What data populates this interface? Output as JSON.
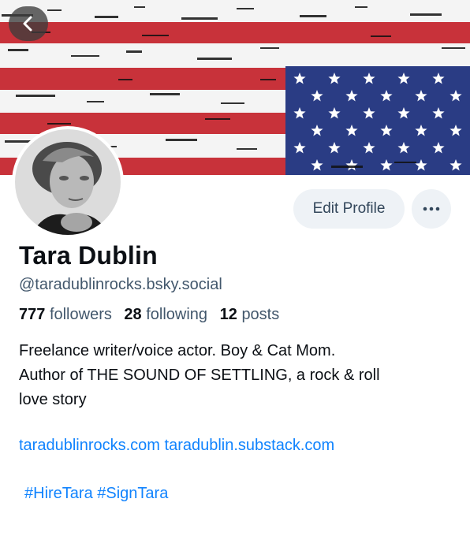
{
  "profile": {
    "display_name": "Tara Dublin",
    "handle": "@taradublinrocks.bsky.social",
    "stats": {
      "followers_count": "777",
      "followers_label": "followers",
      "following_count": "28",
      "following_label": "following",
      "posts_count": "12",
      "posts_label": "posts"
    },
    "bio_lines": [
      "Freelance writer/voice actor. Boy & Cat Mom.",
      "Author of THE SOUND OF SETTLING, a rock & roll",
      "love story"
    ],
    "links": [
      "taradublinrocks.com",
      "taradublin.substack.com"
    ],
    "hashtags": [
      "#HireTara",
      "#SignTara"
    ]
  },
  "actions": {
    "edit_profile_label": "Edit Profile",
    "more_icon": "ellipsis-icon",
    "back_icon": "chevron-left-icon"
  },
  "colors": {
    "link": "#1083fe",
    "flag_red": "#c8323a",
    "flag_blue": "#2a3c84",
    "button_bg": "#eef2f6"
  }
}
